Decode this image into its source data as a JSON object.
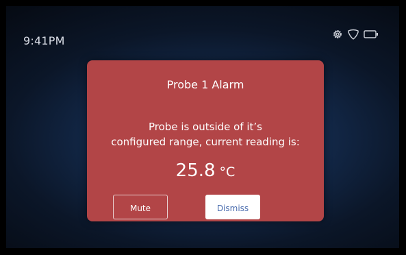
{
  "status_bar": {
    "time": "9:41PM",
    "icons": [
      "gear-icon",
      "shield-icon",
      "battery-icon"
    ]
  },
  "alarm": {
    "title": "Probe 1 Alarm",
    "message_line1": "Probe is outside of it’s",
    "message_line2": "configured range, current reading is:",
    "reading_value": "25.8",
    "reading_unit": "°C",
    "mute_label": "Mute",
    "dismiss_label": "Dismiss",
    "background_color": "#b24547"
  }
}
